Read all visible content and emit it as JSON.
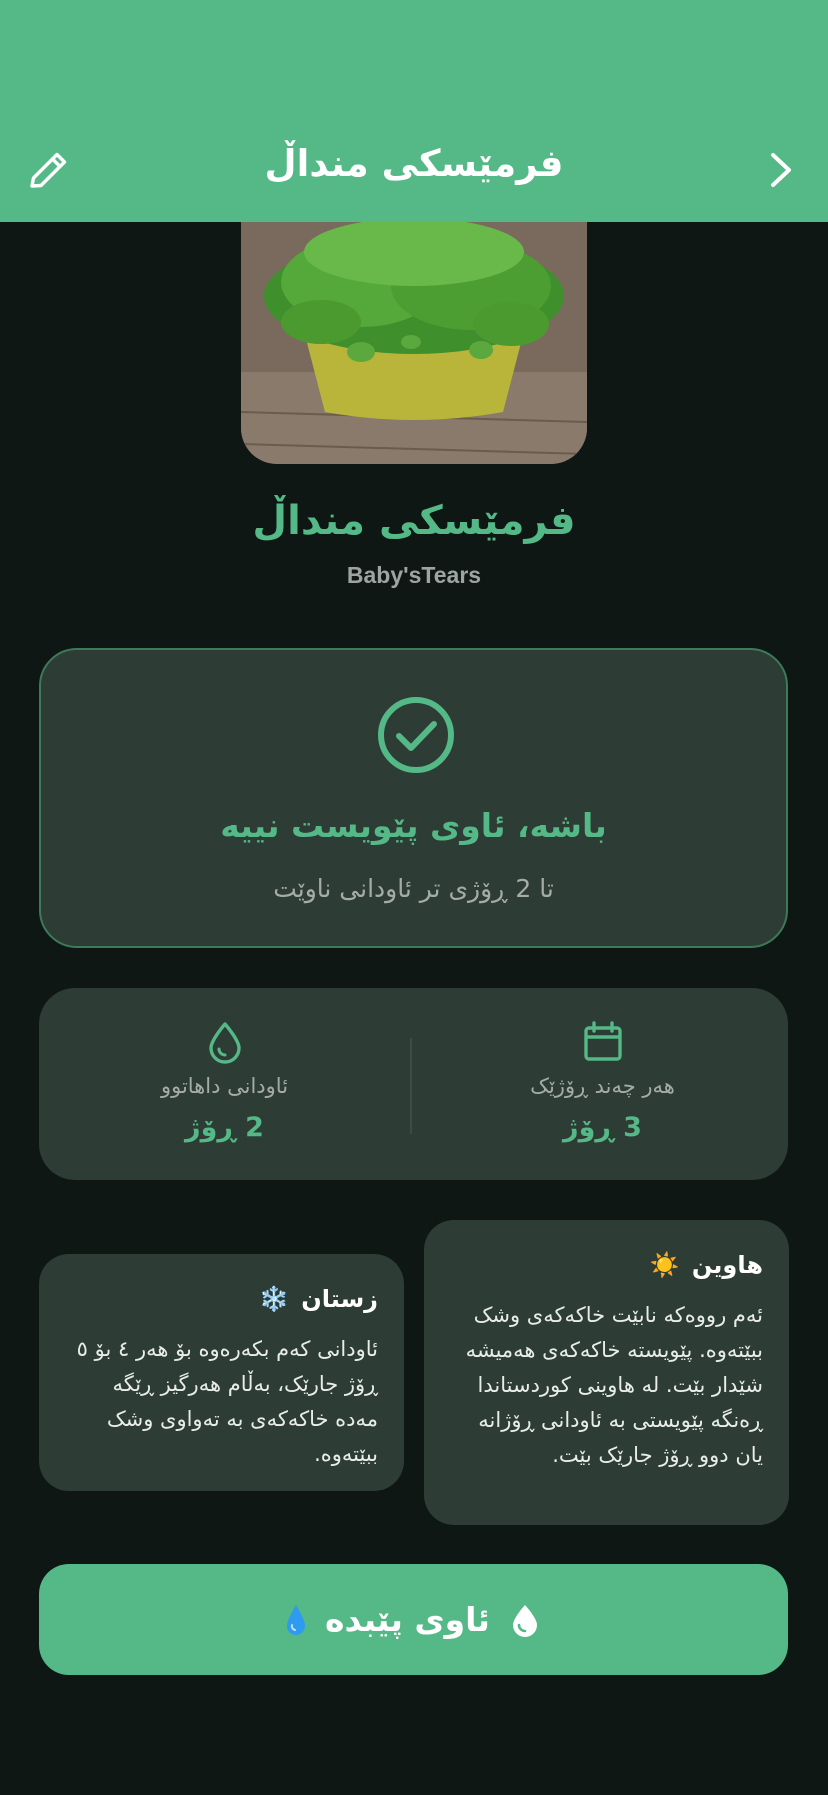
{
  "header": {
    "title": "فرمێسکی منداڵ"
  },
  "plant": {
    "name": "فرمێسکی منداڵ",
    "latin_name": "Baby'sTears"
  },
  "status": {
    "title": "باشە، ئاوی پێویست نییە",
    "subtitle": "تا 2 ڕۆژی تر ئاودانی ناوێت"
  },
  "stats": {
    "frequency": {
      "label": "هەر چەند ڕۆژێک",
      "value": "3 ڕۆژ",
      "icon": "calendar-icon"
    },
    "next_watering": {
      "label": "ئاودانی داهاتوو",
      "value": "2 ڕۆژ",
      "icon": "droplet-icon"
    }
  },
  "seasons": {
    "summer": {
      "title": "هاوین",
      "emoji": "☀️",
      "text": "ئەم رووەکە نابێت خاکەکەی وشک ببێتەوە. پێویستە خاکەکەی هەمیشە شێدار بێت. لە هاوینی کوردستاندا ڕەنگە پێویستی بە ئاودانی ڕۆژانە یان دوو ڕۆژ جارێک بێت."
    },
    "winter": {
      "title": "زستان",
      "emoji": "❄️",
      "text": "ئاودانی کەم بکەرەوە بۆ هەر ٤ بۆ ٥ ڕۆژ جارێک، بەڵام هەرگیز ڕێگە مەدە خاکەکەی بە تەواوی وشک ببێتەوە."
    }
  },
  "action": {
    "water_label": "ئاوی پێبدە",
    "emoji": "💧"
  },
  "colors": {
    "accent": "#54b887",
    "background": "#0e1714",
    "card": "#2d3c35"
  }
}
